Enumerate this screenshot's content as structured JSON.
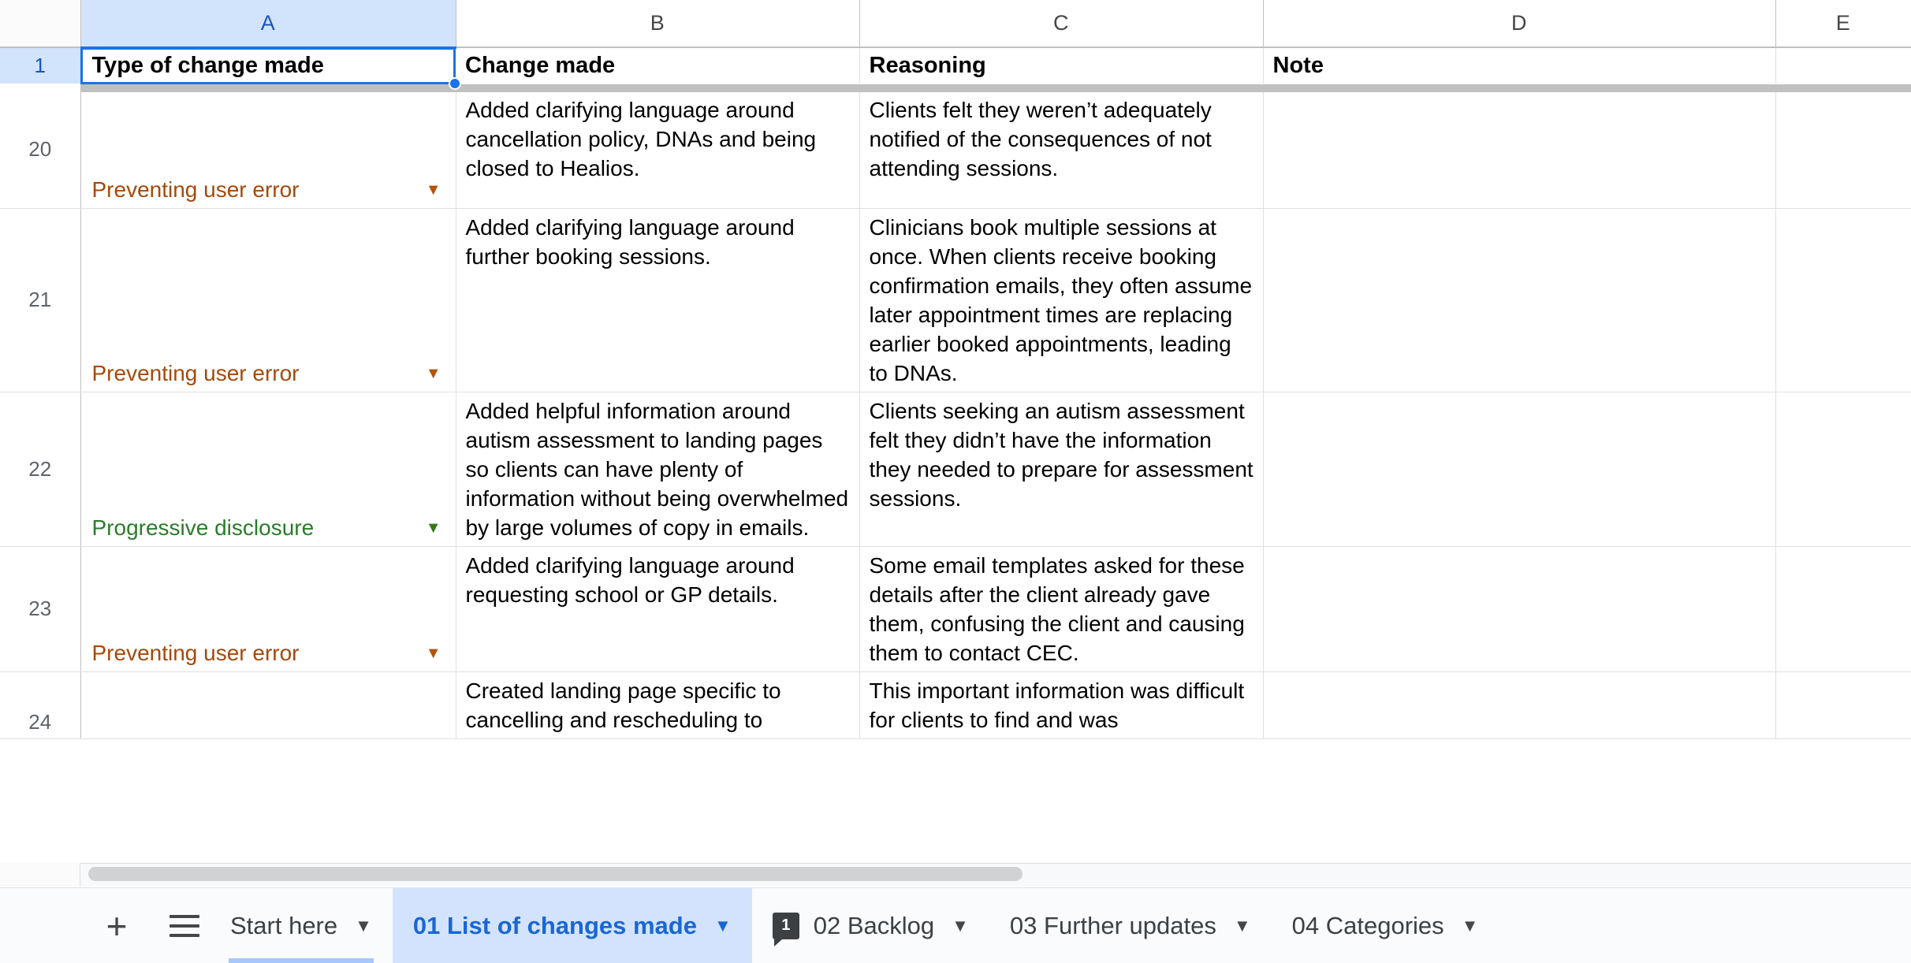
{
  "spreadsheet": {
    "columns": [
      {
        "id": "A",
        "label": "A",
        "selected": true
      },
      {
        "id": "B",
        "label": "B",
        "selected": false
      },
      {
        "id": "C",
        "label": "C",
        "selected": false
      },
      {
        "id": "D",
        "label": "D",
        "selected": false
      },
      {
        "id": "E",
        "label": "E",
        "selected": false
      }
    ],
    "header_row": {
      "number": "1",
      "a": "Type of change made",
      "b": "Change made",
      "c": "Reasoning",
      "d": "Note",
      "e": ""
    },
    "active_cell": "A1",
    "rows": [
      {
        "number": "20",
        "category": "Preventing user error",
        "category_color": "orange",
        "change": "Added clarifying language around cancellation policy, DNAs and being closed to Healios.",
        "reasoning": "Clients felt they weren’t adequately notified of the consequences of not attending sessions.",
        "note": "",
        "e": ""
      },
      {
        "number": "21",
        "category": "Preventing user error",
        "category_color": "orange",
        "change": "Added clarifying language around further booking sessions.",
        "reasoning": "Clinicians book multiple sessions at once. When clients receive booking confirmation emails, they often assume later appointment times are replacing earlier booked appointments, leading to DNAs.",
        "note": "",
        "e": ""
      },
      {
        "number": "22",
        "category": "Progressive disclosure",
        "category_color": "green",
        "change": "Added helpful information around autism assessment to landing pages so clients can have plenty of information without being overwhelmed by large volumes of copy in emails.",
        "reasoning": "Clients seeking an autism assessment felt they didn’t have the information they needed to prepare for assessment sessions.",
        "note": "",
        "e": ""
      },
      {
        "number": "23",
        "category": "Preventing user error",
        "category_color": "orange",
        "change": "Added clarifying language around requesting school or GP details.",
        "reasoning": "Some email templates asked for these details after the client already gave them, confusing the client and causing them to contact CEC.",
        "note": "",
        "e": ""
      },
      {
        "number": "24",
        "category": "",
        "category_color": "green",
        "change": "Created landing page specific to cancelling and rescheduling to",
        "reasoning": "This important information was difficult for clients to find and was",
        "note": "",
        "e": ""
      }
    ]
  },
  "tabbar": {
    "add_label": "+",
    "menu_label": "☰",
    "chevron": "▼",
    "tabs": [
      {
        "label": "Start here",
        "active": false,
        "badge": null
      },
      {
        "label": "01 List of changes made",
        "active": true,
        "badge": null
      },
      {
        "label": "02 Backlog",
        "active": false,
        "badge": "1"
      },
      {
        "label": "03 Further updates",
        "active": false,
        "badge": null
      },
      {
        "label": "04 Categories",
        "active": false,
        "badge": null
      }
    ]
  },
  "colors": {
    "accent": "#1a73e8",
    "active_tab_bg": "#d3e3fd",
    "active_tab_text": "#1967d2",
    "category_orange_bg": "#fbcdab",
    "category_orange_text": "#a6490a",
    "category_green_bg": "#d5ebbf",
    "category_green_text": "#2d7a2d",
    "selected_col_header_bg": "#d2e3fc"
  }
}
